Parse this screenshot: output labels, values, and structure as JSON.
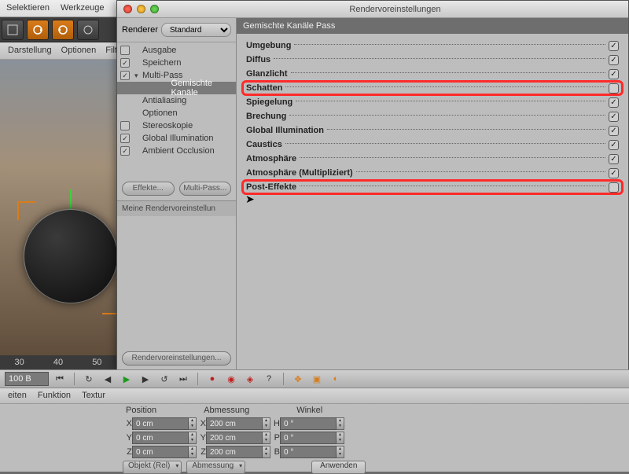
{
  "title": "Rendervoreinstellungen",
  "main_menu": [
    "Selektieren",
    "Werkzeuge"
  ],
  "main_tabs": [
    "Darstellung",
    "Optionen",
    "Filt"
  ],
  "renderer_label": "Renderer",
  "renderer_value": "Standard",
  "tree": [
    {
      "label": "Ausgabe",
      "cb": false,
      "child": true
    },
    {
      "label": "Speichern",
      "cb": true,
      "child": true
    },
    {
      "label": "Multi-Pass",
      "cb": true,
      "child": true,
      "arrow": "▾"
    },
    {
      "label": "Gemischte Kanäle",
      "cb": null,
      "child": true,
      "indent": true,
      "sel": true
    },
    {
      "label": "Antialiasing",
      "cb": null,
      "child": true
    },
    {
      "label": "Optionen",
      "cb": null,
      "child": true
    },
    {
      "label": "Stereoskopie",
      "cb": false,
      "child": true
    },
    {
      "label": "Global Illumination",
      "cb": true,
      "child": true
    },
    {
      "label": "Ambient Occlusion",
      "cb": true,
      "child": true
    }
  ],
  "effects_btn": "Effekte...",
  "multipass_btn": "Multi-Pass...",
  "preset_label": "Meine Rendervoreinstellun",
  "preset_btn": "Rendervoreinstellungen...",
  "detail_header": "Gemischte Kanäle Pass",
  "passes": [
    {
      "label": "Umgebung",
      "on": true
    },
    {
      "label": "Diffus",
      "on": true
    },
    {
      "label": "Glanzlicht",
      "on": true
    },
    {
      "label": "Schatten",
      "on": false,
      "hl": true
    },
    {
      "label": "Spiegelung",
      "on": true
    },
    {
      "label": "Brechung",
      "on": true
    },
    {
      "label": "Global Illumination",
      "on": true
    },
    {
      "label": "Caustics",
      "on": true
    },
    {
      "label": "Atmosphäre",
      "on": true
    },
    {
      "label": "Atmosphäre (Multipliziert)",
      "on": true
    },
    {
      "label": "Post-Effekte",
      "on": false,
      "hl": true
    }
  ],
  "timeline_ticks": [
    "30",
    "40",
    "50"
  ],
  "frame": "100 B",
  "coords_tabs": [
    "eiten",
    "Funktion",
    "Textur"
  ],
  "coords_headers": [
    "Position",
    "Abmessung",
    "Winkel"
  ],
  "coords_rows": [
    {
      "a": "X",
      "av": "0 cm",
      "b": "X",
      "bv": "200 cm",
      "c": "H",
      "cv": "0 °"
    },
    {
      "a": "Y",
      "av": "0 cm",
      "b": "Y",
      "bv": "200 cm",
      "c": "P",
      "cv": "0 °"
    },
    {
      "a": "Z",
      "av": "0 cm",
      "b": "Z",
      "bv": "200 cm",
      "c": "B",
      "cv": "0 °"
    }
  ],
  "obj_mode": "Objekt (Rel)",
  "dim_mode": "Abmessung",
  "apply": "Anwenden"
}
